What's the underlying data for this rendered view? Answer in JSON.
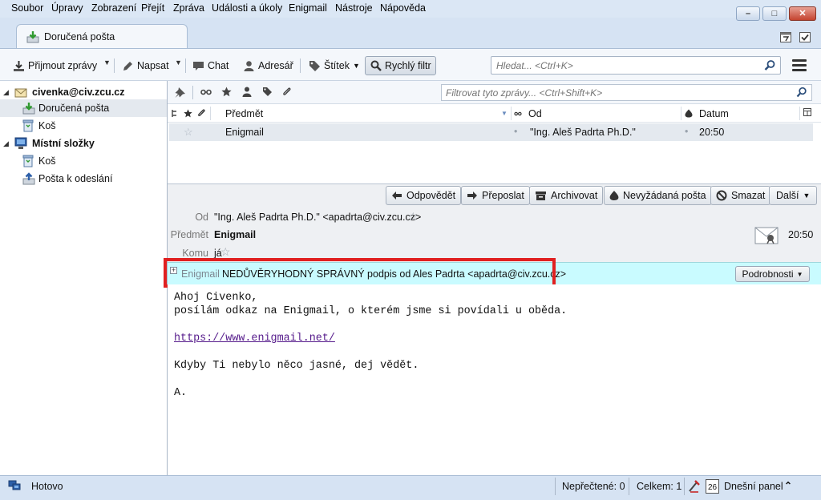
{
  "menu": [
    "Soubor",
    "Úpravy",
    "Zobrazení",
    "Přejít",
    "Zpráva",
    "Události a úkoly",
    "Enigmail",
    "Nástroje",
    "Nápověda"
  ],
  "window": {
    "minimize": "–",
    "maximize": "□",
    "close": "✕"
  },
  "tabs": [
    {
      "label": "Doručená pošta"
    }
  ],
  "toolbar": {
    "get_messages": "Přijmout zprávy",
    "write": "Napsat",
    "chat": "Chat",
    "address_book": "Adresář",
    "tag": "Štítek",
    "quick_filter": "Rychlý filtr",
    "search_placeholder": "Hledat... <Ctrl+K>"
  },
  "folders": {
    "account": "civenka@civ.zcu.cz",
    "inbox": "Doručená pošta",
    "trash": "Koš",
    "local": "Místní složky",
    "local_trash": "Koš",
    "outbox": "Pošta k odeslání"
  },
  "thread": {
    "filter_placeholder": "Filtrovat tyto zprávy... <Ctrl+Shift+K>",
    "columns": {
      "subject": "Předmět",
      "from": "Od",
      "date": "Datum"
    },
    "rows": [
      {
        "subject": "Enigmail",
        "from": "\"Ing. Aleš Padrta Ph.D.\"",
        "date": "20:50"
      }
    ]
  },
  "actions": {
    "reply": "Odpovědět",
    "forward": "Přeposlat",
    "archive": "Archivovat",
    "junk": "Nevyžádaná pošta",
    "delete": "Smazat",
    "more": "Další"
  },
  "message": {
    "from_label": "Od",
    "from": "\"Ing. Aleš Padrta Ph.D.\" <apadrta@civ.zcu.cz>",
    "subject_label": "Předmět",
    "subject": "Enigmail",
    "to_label": "Komu",
    "to": "já",
    "time": "20:50",
    "enigmail_label": "Enigmail",
    "enigmail_status": "NEDŮVĚRYHODNÝ SPRÁVNÝ podpis od Ales Padrta <apadrta@civ.zcu.cz>",
    "details": "Podrobnosti",
    "body": {
      "line1": "Ahoj Civenko,",
      "line2": "posílám odkaz na Enigmail, o kterém jsme si povídali u oběda.",
      "link": "https://www.enigmail.net/",
      "line4": "Kdyby Ti nebylo něco jasné, dej vědět.",
      "line5": "A."
    }
  },
  "status": {
    "text": "Hotovo",
    "unread": "Nepřečtené: 0",
    "total": "Celkem: 1",
    "today_panel": "Dnešní panel",
    "calendar_day": "26"
  },
  "colors": {
    "enigmail_bar": "#c9fbff",
    "highlight": "#e02020",
    "selection": "#e4e9ef"
  }
}
